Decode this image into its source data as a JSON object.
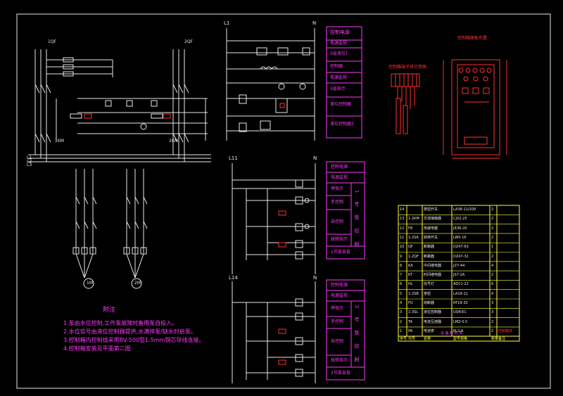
{
  "main_circuit": {
    "bus_L1": "L1",
    "bus_L2": "L2",
    "bus_L3": "L3",
    "pump1_qf": "1QF",
    "pump2_qf": "2QF",
    "km1": "1KM",
    "km2": "2KM",
    "motor1": "1M",
    "motor2": "2M"
  },
  "notes": {
    "title": "附注",
    "items": [
      "1.泵由水位控制,工作泵故障时备用泵自投入。",
      "2.水位信号由液位控制器提供,水满停泵/缺水时启泵。",
      "3.控制箱内控制线采用BV-500型1.5mm铜芯导线连接。",
      "4.控制箱安装见平面第二图"
    ]
  },
  "control_top": {
    "bus_left": "L1",
    "bus_right": "N",
    "labels": [
      "控制电源",
      "电源监视",
      "5层液位T",
      "控制器",
      "电源监视",
      "5层指示",
      "液位控制器",
      "液位控制器2"
    ]
  },
  "control_pump1": {
    "bus_left": "L11",
    "bus_right": "N",
    "labels": [
      "控制电源",
      "电源监视",
      "停指示",
      "手控制",
      "自控制",
      "故障指示",
      "1号泵自投"
    ],
    "side_label": "1号泵控制"
  },
  "control_pump2": {
    "bus_left": "L14",
    "bus_right": "N",
    "labels": [
      "控制电源",
      "电源监视",
      "停指示",
      "手控制",
      "自控制",
      "故障指示",
      "2号泵自投"
    ],
    "side_label": "2号泵控制"
  },
  "terminal_diagram": {
    "title": "控制箱端子排示意图"
  },
  "panel_layout": {
    "title": "控制箱面板布置"
  },
  "bom": {
    "rows": [
      [
        "14",
        "",
        "按钮开关",
        "LA38-11/209",
        "2",
        ""
      ],
      [
        "13",
        "1-2KM",
        "交流接触器",
        "CJX2-25",
        "2",
        ""
      ],
      [
        "12",
        "FR",
        "热继电器",
        "JR36-20",
        "2",
        ""
      ],
      [
        "11",
        "1-2SA",
        "转换开关",
        "LW5-16",
        "2",
        ""
      ],
      [
        "10",
        "QF",
        "断路器",
        "DZ47-63",
        "1",
        ""
      ],
      [
        "9",
        "1-2QF",
        "断路器",
        "DZ47-32",
        "2",
        ""
      ],
      [
        "8",
        "KA",
        "中间继电器",
        "JZ7-44",
        "4",
        ""
      ],
      [
        "7",
        "KT",
        "时间继电器",
        "JS7-2A",
        "2",
        ""
      ],
      [
        "6",
        "HL",
        "信号灯",
        "AD11-22",
        "6",
        ""
      ],
      [
        "5",
        "1-2SB",
        "按钮",
        "LA19-11",
        "4",
        ""
      ],
      [
        "4",
        "FU",
        "熔断器",
        "RT18-32",
        "3",
        ""
      ],
      [
        "3",
        "1-3SL",
        "液位控制器",
        "UQK-61",
        "3",
        ""
      ],
      [
        "2",
        "TA",
        "电流互感器",
        "LMZ-0.5",
        "2",
        ""
      ],
      [
        "1",
        "PA",
        "电流表",
        "6L2-A",
        "2",
        "控制箱体"
      ]
    ],
    "header": [
      "序号",
      "代号",
      "名称",
      "型号规格",
      "数量",
      "备注"
    ],
    "footer": "设 备 材 料 表"
  }
}
